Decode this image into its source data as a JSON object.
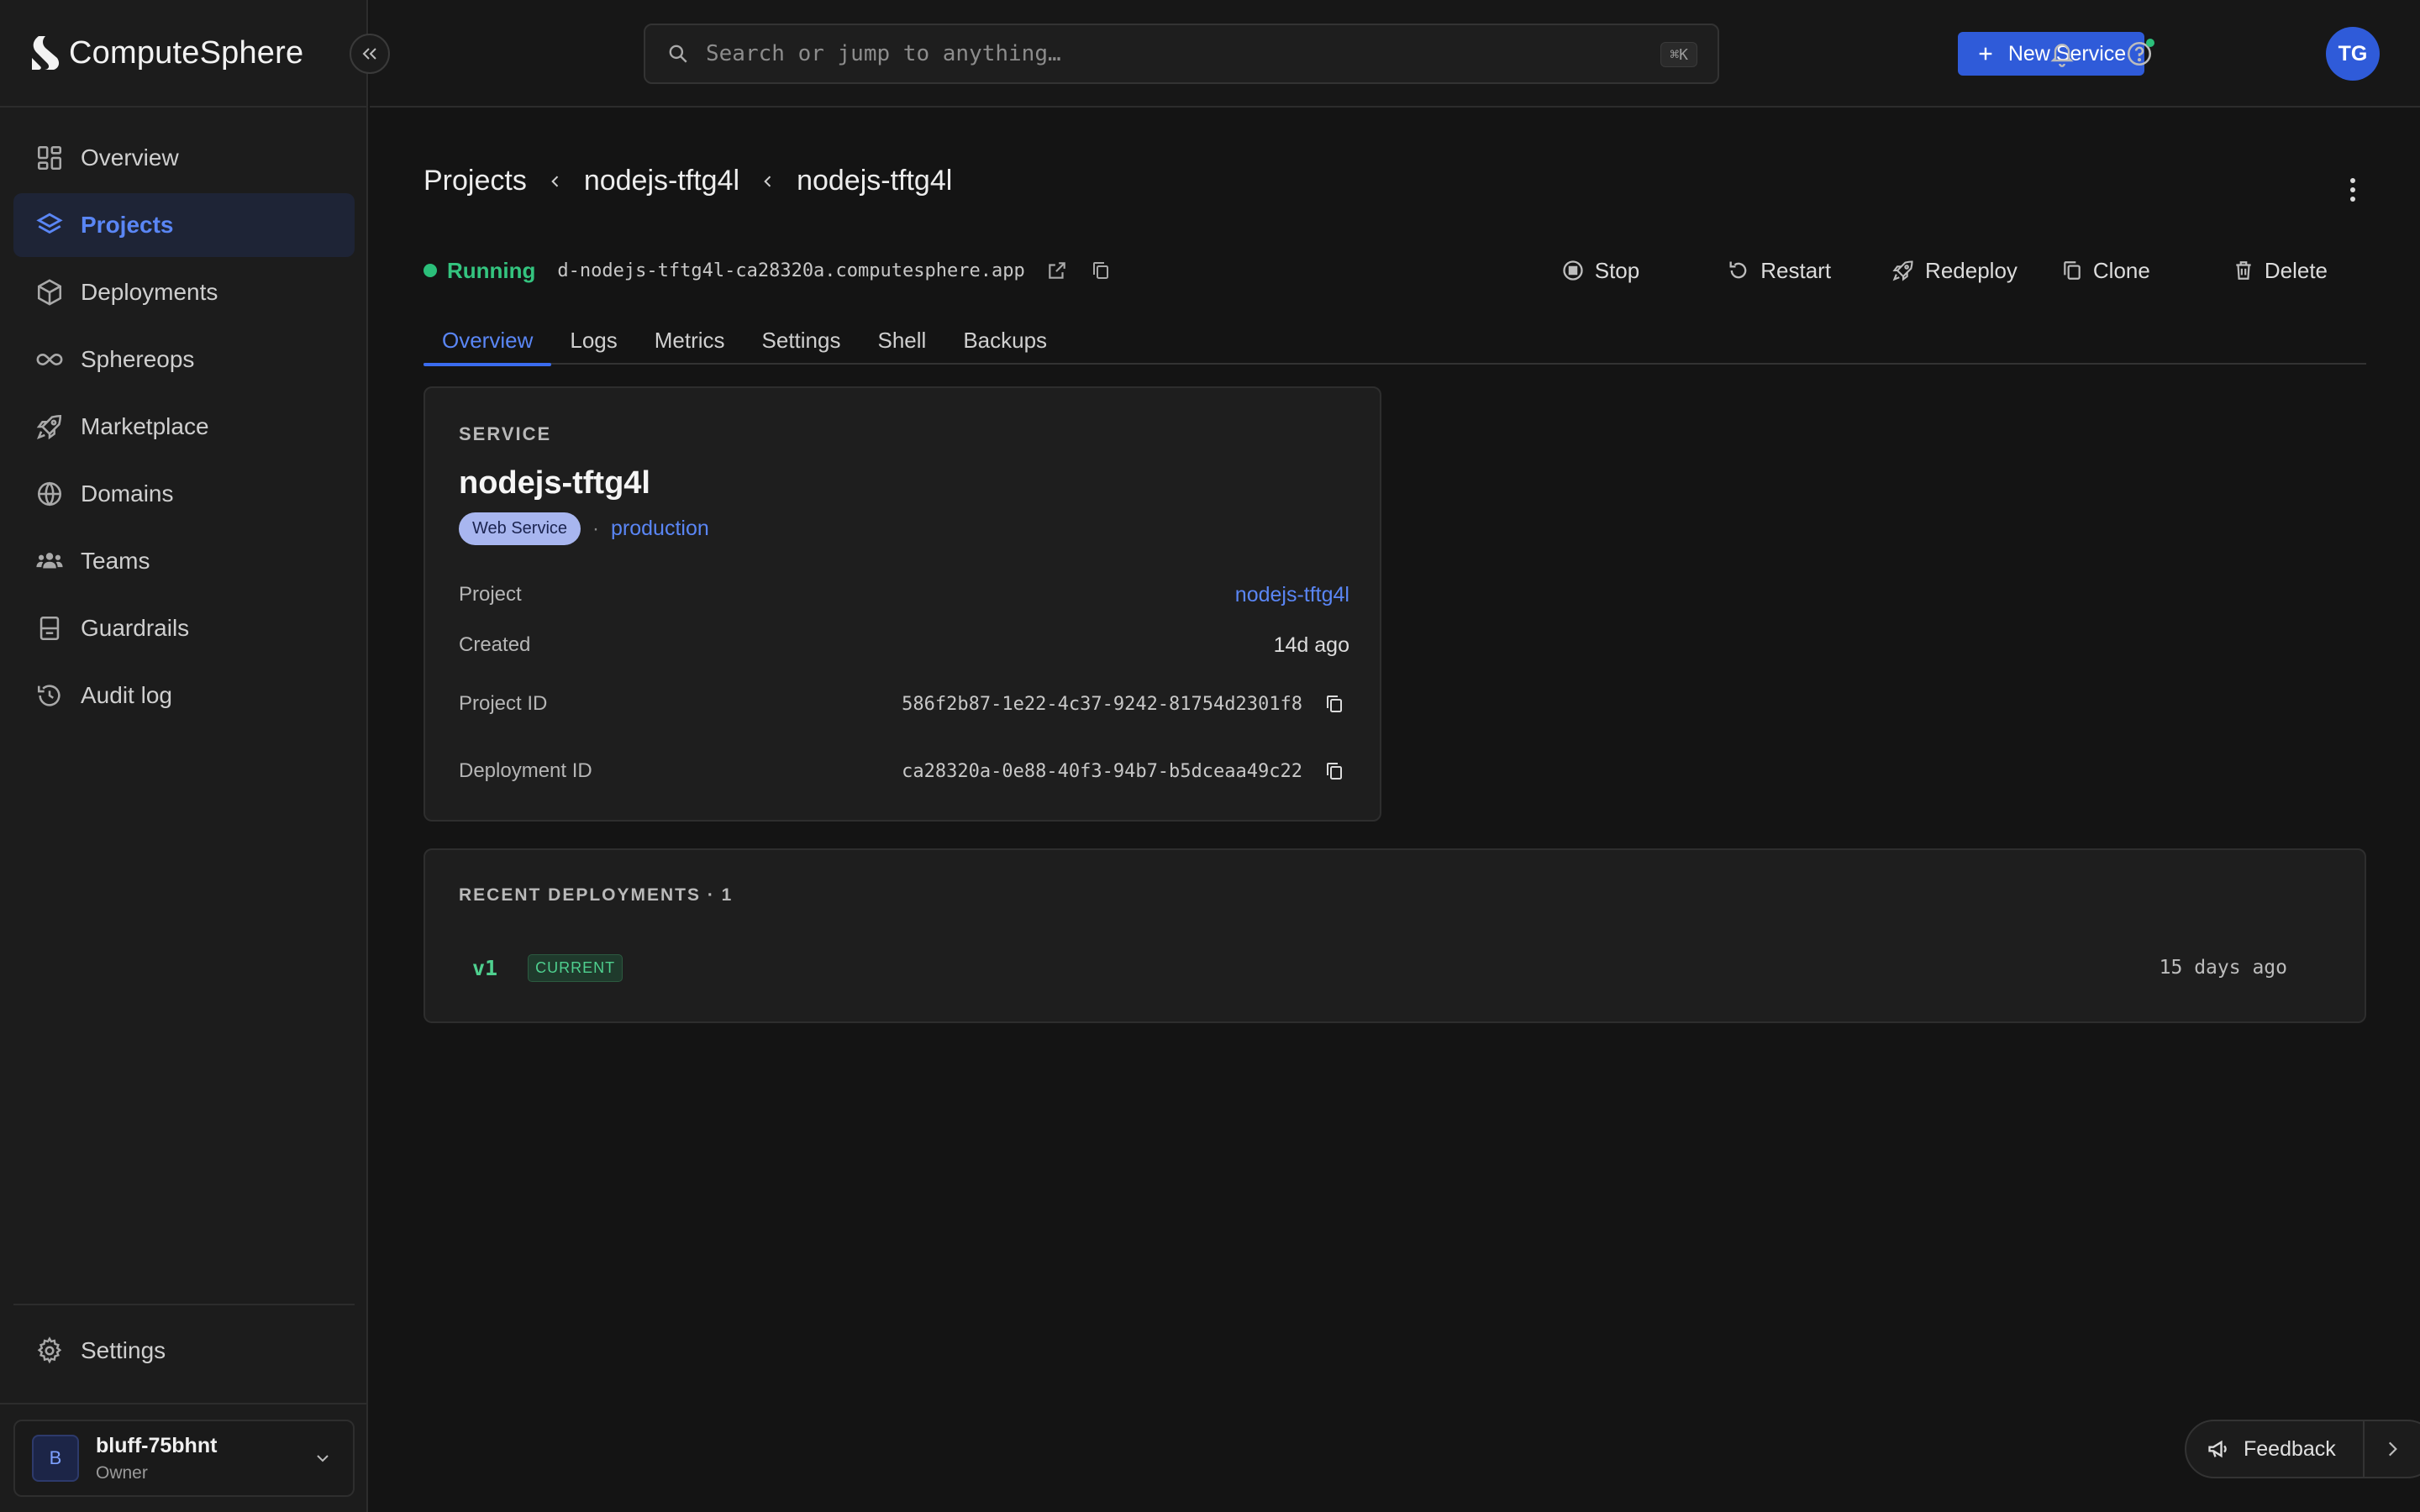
{
  "app": {
    "name": "ComputeSphere"
  },
  "search": {
    "placeholder": "Search or jump to anything…",
    "shortcut": "⌘K"
  },
  "topbar": {
    "new_service_label": "New Service",
    "avatar_initials": "TG"
  },
  "sidebar": {
    "items": [
      {
        "label": "Overview",
        "icon": "grid-icon"
      },
      {
        "label": "Projects",
        "icon": "layers-icon",
        "active": true
      },
      {
        "label": "Deployments",
        "icon": "box-icon"
      },
      {
        "label": "Sphereops",
        "icon": "infinity-icon"
      },
      {
        "label": "Marketplace",
        "icon": "rocket-icon"
      },
      {
        "label": "Domains",
        "icon": "globe-icon"
      },
      {
        "label": "Teams",
        "icon": "users-icon"
      },
      {
        "label": "Guardrails",
        "icon": "guardrail-icon"
      },
      {
        "label": "Audit log",
        "icon": "history-icon"
      }
    ],
    "settings_label": "Settings",
    "account": {
      "initial": "B",
      "name": "bluff-75bhnt",
      "role": "Owner"
    }
  },
  "breadcrumb": [
    "Projects",
    "nodejs-tftg4l",
    "nodejs-tftg4l"
  ],
  "status": {
    "label": "Running",
    "url": "d-nodejs-tftg4l-ca28320a.computesphere.app"
  },
  "actions": {
    "stop": "Stop",
    "restart": "Restart",
    "redeploy": "Redeploy",
    "clone": "Clone",
    "delete": "Delete"
  },
  "tabs": [
    "Overview",
    "Logs",
    "Metrics",
    "Settings",
    "Shell",
    "Backups"
  ],
  "service": {
    "section_label": "SERVICE",
    "name": "nodejs-tftg4l",
    "type_badge": "Web Service",
    "separator": "·",
    "environment": "production",
    "fields": {
      "project": {
        "label": "Project",
        "value": "nodejs-tftg4l"
      },
      "created": {
        "label": "Created",
        "value": "14d ago"
      },
      "project_id": {
        "label": "Project ID",
        "value": "586f2b87-1e22-4c37-9242-81754d2301f8"
      },
      "deployment_id": {
        "label": "Deployment ID",
        "value": "ca28320a-0e88-40f3-94b7-b5dceaa49c22"
      }
    }
  },
  "deployments": {
    "section_label": "RECENT DEPLOYMENTS · 1",
    "items": [
      {
        "version": "v1",
        "badge": "CURRENT",
        "time": "15 days ago"
      }
    ]
  },
  "feedback": {
    "label": "Feedback"
  },
  "colors": {
    "accent": "#2f5bd9",
    "link": "#5a86f5",
    "running": "#2bbf7a",
    "background": "#141414"
  }
}
